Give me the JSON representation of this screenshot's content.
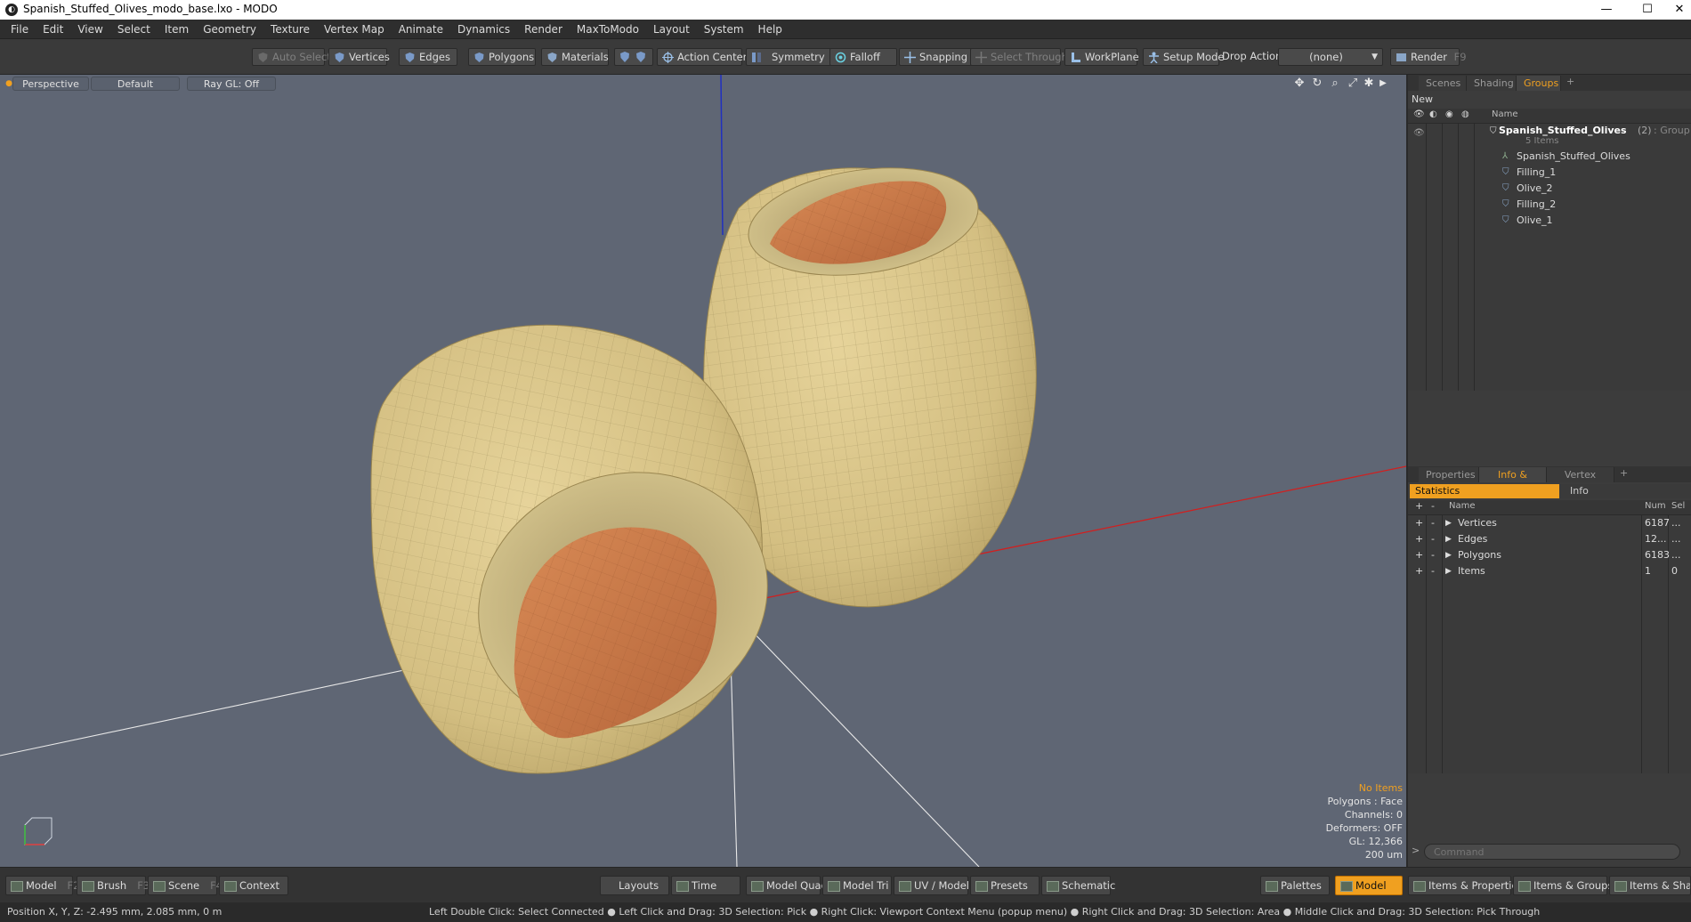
{
  "window": {
    "title": "Spanish_Stuffed_Olives_modo_base.lxo - MODO",
    "minimize": "—",
    "maximize": "☐",
    "close": "✕"
  },
  "menu": [
    "File",
    "Edit",
    "View",
    "Select",
    "Item",
    "Geometry",
    "Texture",
    "Vertex Map",
    "Animate",
    "Dynamics",
    "Render",
    "MaxToModo",
    "Layout",
    "System",
    "Help"
  ],
  "toolbar": {
    "auto_select": "Auto Select",
    "vertices": "Vertices",
    "edges": "Edges",
    "polygons": "Polygons",
    "materials": "Materials",
    "action_center": "Action Center",
    "symmetry": "Symmetry",
    "falloff": "Falloff",
    "snapping": "Snapping",
    "select_through": "Select Through",
    "workplane": "WorkPlane",
    "setup_mode": "Setup Mode",
    "drop_action_label": "Drop Action",
    "drop_action_value": "(none)",
    "render": "Render",
    "render_key": "F9"
  },
  "viewport": {
    "view": "Perspective",
    "style": "Default",
    "raygl": "Ray GL: Off",
    "hud": {
      "selection": "No Items",
      "polygons": "Polygons : Face",
      "channels": "Channels: 0",
      "deformers": "Deformers: OFF",
      "gl": "GL: 12,366",
      "scale": "200 um"
    }
  },
  "scene_panel": {
    "tabs": [
      "Scenes",
      "Shading",
      "Groups"
    ],
    "active_tab": "Groups",
    "new_group": "New Group",
    "col_name": "Name",
    "group_name": "Spanish_Stuffed_Olives",
    "group_count": "(2)",
    "group_type": ": Group",
    "group_sub": "5 Items",
    "items": [
      "Spanish_Stuffed_Olives",
      "Filling_1",
      "Olive_2",
      "Filling_2",
      "Olive_1"
    ]
  },
  "info_panel": {
    "tabs": [
      "Properties",
      "Info & Stats",
      "Vertex Maps"
    ],
    "active_tab": "Info & Stats",
    "subtabs": [
      "Statistics",
      "Info"
    ],
    "cols": {
      "name": "Name",
      "num": "Num",
      "sel": "Sel"
    },
    "rows": [
      {
        "name": "Vertices",
        "num": "6187",
        "sel": "..."
      },
      {
        "name": "Edges",
        "num": "12...",
        "sel": "..."
      },
      {
        "name": "Polygons",
        "num": "6183",
        "sel": "..."
      },
      {
        "name": "Items",
        "num": "1",
        "sel": "0"
      }
    ],
    "command_placeholder": "Command"
  },
  "bottombar": {
    "model": "Model",
    "model_key": "F2",
    "brush": "Brush",
    "brush_key": "F3",
    "scene": "Scene",
    "scene_key": "F4",
    "context": "Context",
    "layouts": "Layouts",
    "time": "Time",
    "model_quad": "Model Quad",
    "model_tri": "Model Tri",
    "uv_model": "UV / Model",
    "presets": "Presets",
    "schematic": "Schematic",
    "palettes": "Palettes",
    "model_mode": "Model",
    "items_properties": "Items & Properties",
    "items_groups": "Items & Groups",
    "items_shading": "Items & Shadin"
  },
  "status": {
    "position": "Position X, Y, Z:   -2.495 mm, 2.085 mm, 0 m",
    "hints": "Left Double Click: Select Connected ● Left Click and Drag: 3D Selection: Pick ● Right Click: Viewport Context Menu (popup menu) ● Right Click and Drag: 3D Selection: Area ● Middle Click and Drag: 3D Selection: Pick Through"
  },
  "colors": {
    "accent": "#f0a020",
    "viewport_bg": "#5f6674",
    "olive": "#d8c48a",
    "pimiento": "#c77845"
  }
}
